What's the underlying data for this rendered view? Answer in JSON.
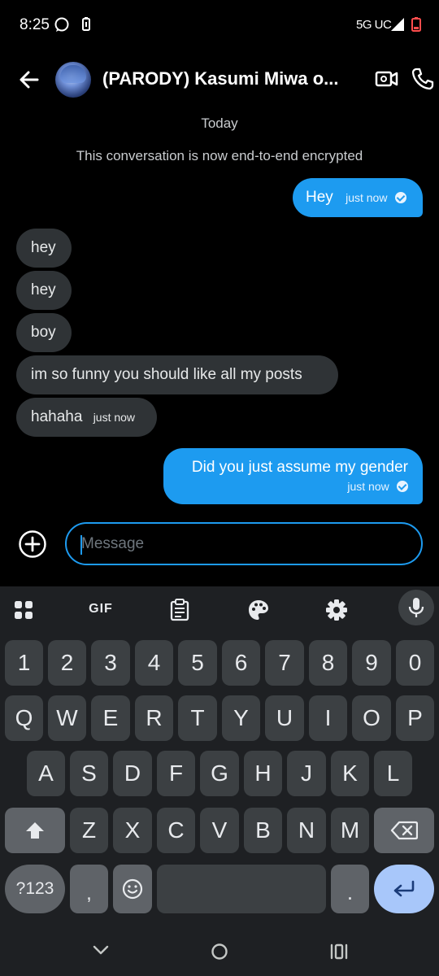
{
  "status": {
    "time": "8:25",
    "network": "5G UC"
  },
  "header": {
    "title": "(PARODY) Kasumi Miwa o..."
  },
  "conversation": {
    "date_label": "Today",
    "encryption_notice": "This conversation is now end-to-end encrypted",
    "messages": [
      {
        "direction": "out",
        "text": "Hey",
        "time": "just now"
      },
      {
        "direction": "in",
        "text": "hey"
      },
      {
        "direction": "in",
        "text": "hey"
      },
      {
        "direction": "in",
        "text": "boy"
      },
      {
        "direction": "in",
        "text": "im so funny you should like all my posts"
      },
      {
        "direction": "in",
        "text": "hahaha",
        "time": "just now"
      },
      {
        "direction": "out",
        "text": "Did you just assume my gender",
        "time": "just now"
      }
    ]
  },
  "composer": {
    "placeholder": "Message"
  },
  "keyboard": {
    "toolbar": [
      "apps-icon",
      "gif",
      "clipboard-icon",
      "palette-icon",
      "settings-icon",
      "mic-icon"
    ],
    "gif_label": "GIF",
    "row_numbers": [
      "1",
      "2",
      "3",
      "4",
      "5",
      "6",
      "7",
      "8",
      "9",
      "0"
    ],
    "row1": [
      "Q",
      "W",
      "E",
      "R",
      "T",
      "Y",
      "U",
      "I",
      "O",
      "P"
    ],
    "row2": [
      "A",
      "S",
      "D",
      "F",
      "G",
      "H",
      "J",
      "K",
      "L"
    ],
    "row3": [
      "Z",
      "X",
      "C",
      "V",
      "B",
      "N",
      "M"
    ],
    "symbols_label": "?123",
    "comma": ",",
    "period": "."
  },
  "colors": {
    "accent": "#1d9bf0",
    "incoming_bubble": "#2f3336",
    "keyboard_bg": "#1e2023",
    "key_bg": "#3c4043"
  }
}
